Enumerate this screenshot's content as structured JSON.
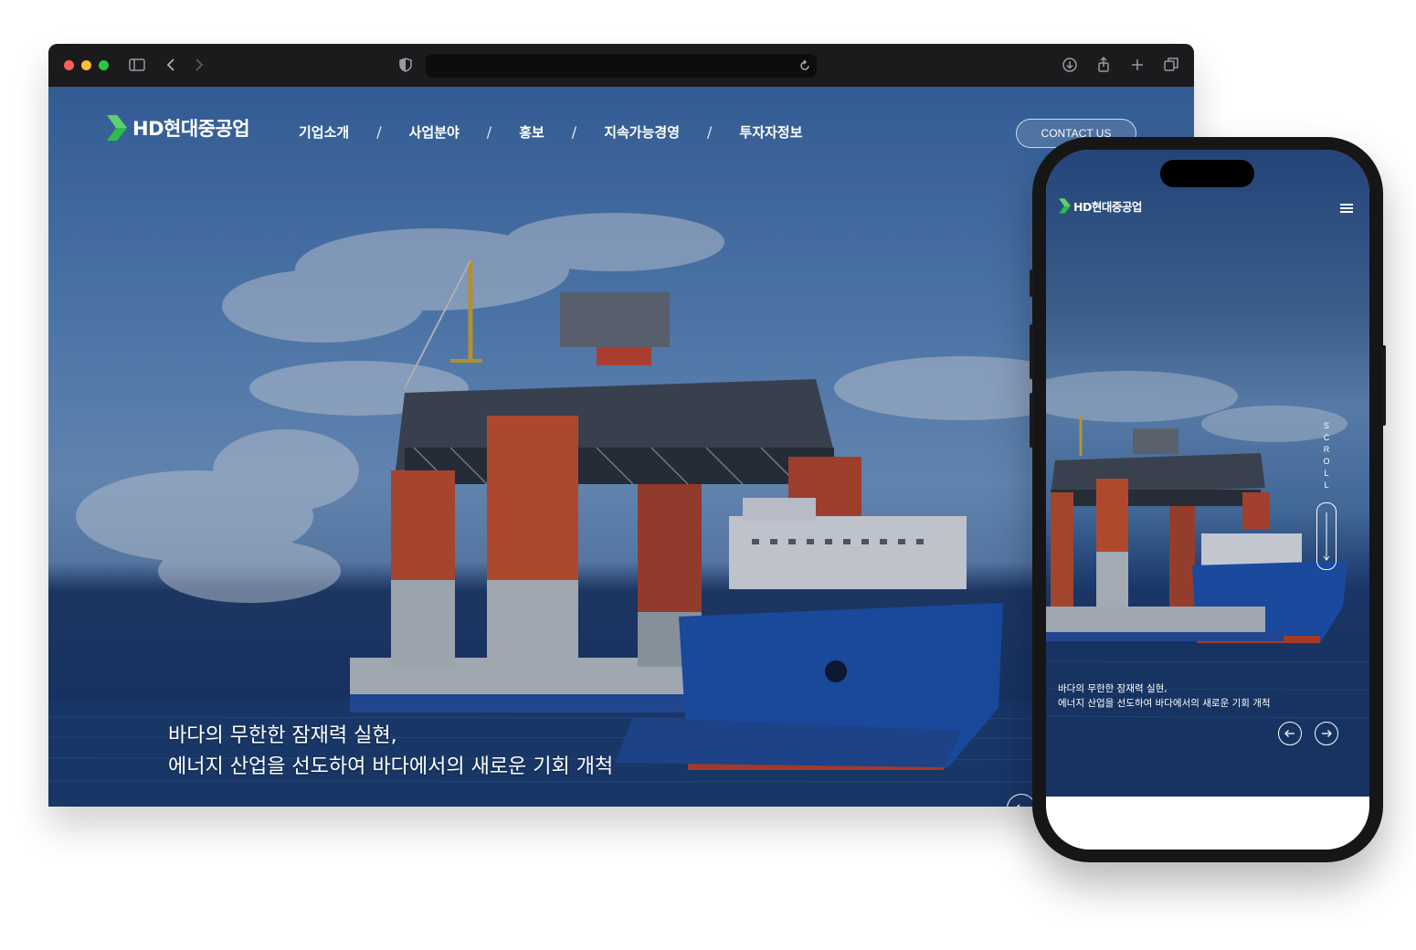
{
  "desktop": {
    "logo": {
      "text": "HD현대중공업",
      "icon": "hd-logo-icon",
      "color": "#2dbb4e"
    },
    "nav": [
      {
        "label": "기업소개"
      },
      {
        "label": "사업분야"
      },
      {
        "label": "홍보"
      },
      {
        "label": "지속가능경영"
      },
      {
        "label": "투자자정보"
      }
    ],
    "nav_separator": "/",
    "contact_label": "CONTACT US",
    "hero": {
      "line1": "바다의 무한한 잠재력 실현,",
      "line2": "에너지 산업을 선도하여 바다에서의 새로운 기회 개척"
    }
  },
  "mobile": {
    "logo": {
      "text": "HD현대중공업"
    },
    "scroll_label": "SCROLL",
    "hero": {
      "line1": "바다의 무한한 잠재력 실현,",
      "line2": "에너지 산업을 선도하여 바다에서의 새로운 기회 개척"
    }
  },
  "colors": {
    "brand_green": "#2dbb4e",
    "hull_blue": "#1f56b8",
    "column_orange": "#d8532a",
    "browser_chrome": "#1b1b1d"
  }
}
